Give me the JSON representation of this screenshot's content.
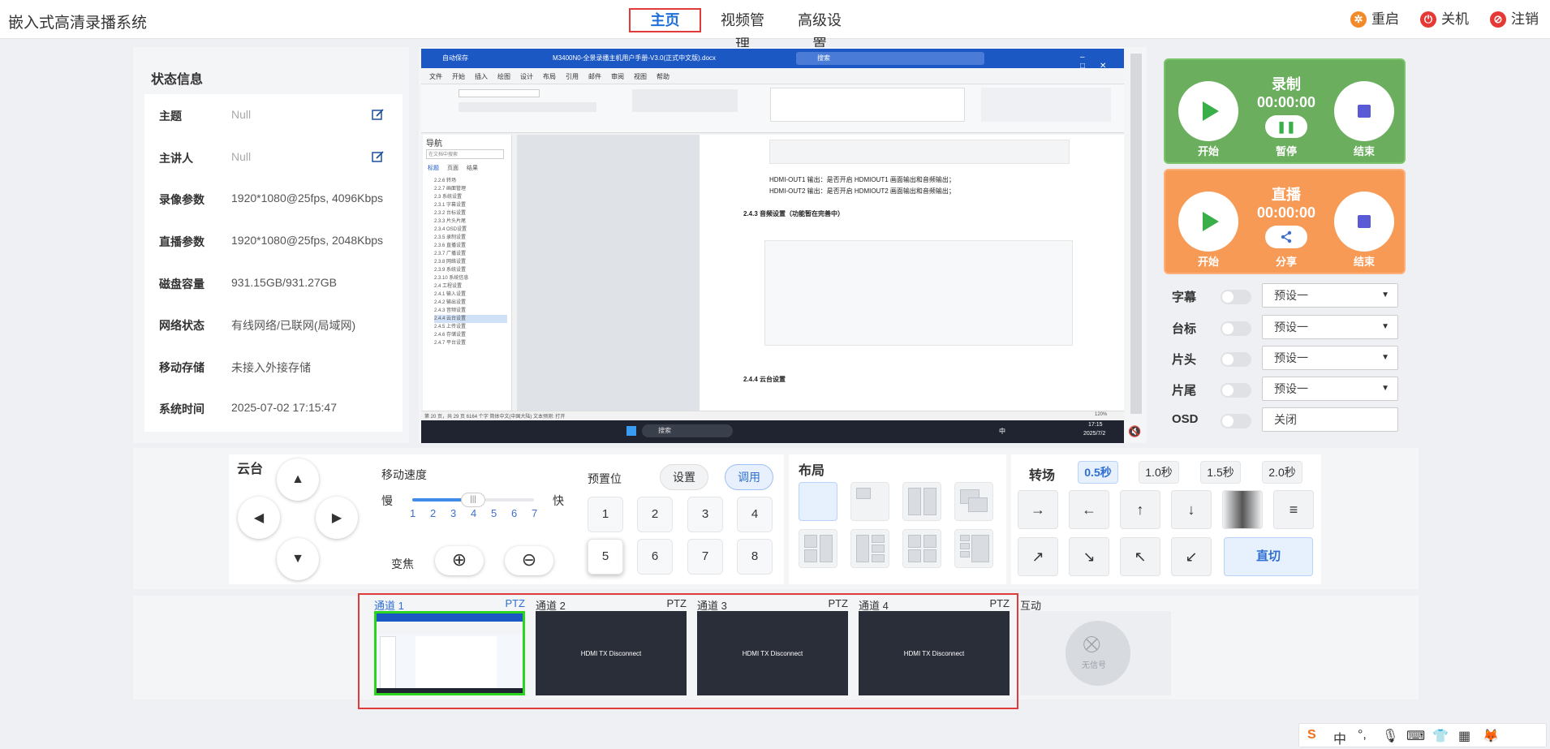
{
  "app": {
    "title": "嵌入式高清录播系统"
  },
  "nav": {
    "home": "主页",
    "video": "视频管理",
    "advanced": "高级设置"
  },
  "header_actions": {
    "restart": "重启",
    "shutdown": "关机",
    "logout": "注销"
  },
  "colors": {
    "accent": "#1e6fd9",
    "record_green": "#6aae5e",
    "live_orange": "#f79a55",
    "highlight_red": "#e03a3a",
    "selected_channel": "#2bd41f"
  },
  "status": {
    "title": "状态信息",
    "rows": [
      {
        "label": "主题",
        "value": "Null",
        "editable": true
      },
      {
        "label": "主讲人",
        "value": "Null",
        "editable": true
      },
      {
        "label": "录像参数",
        "value": "1920*1080@25fps, 4096Kbps"
      },
      {
        "label": "直播参数",
        "value": "1920*1080@25fps, 2048Kbps"
      },
      {
        "label": "磁盘容量",
        "value": "931.15GB/931.27GB"
      },
      {
        "label": "网络状态",
        "value": "有线网络/已联网(局域网)"
      },
      {
        "label": "移动存储",
        "value": "未接入外接存储"
      },
      {
        "label": "系统时间",
        "value": "2025-07-02 17:15:47"
      }
    ]
  },
  "preview": {
    "doc_title": "M3400N0-全景录播主机用户手册-V3.0(正式中文版).docx",
    "autosave": "自动保存",
    "search": "搜索",
    "ribbon_tabs": [
      "文件",
      "开始",
      "插入",
      "绘图",
      "设计",
      "布局",
      "引用",
      "邮件",
      "审阅",
      "视图",
      "帮助"
    ],
    "nav_pane_title": "导航",
    "nav_pane_search": "在文档中搜索",
    "nav_tabs": [
      "标题",
      "页面",
      "结果"
    ],
    "nav_items": [
      "2.2.6 转场",
      "2.2.7 画面管理",
      "2.3 系统设置",
      "2.3.1 字幕设置",
      "2.3.2 台标设置",
      "2.3.3 片头片尾",
      "2.3.4 OSD设置",
      "2.3.5 录制设置",
      "2.3.6 直播设置",
      "2.3.7 广播设置",
      "2.3.8 网络设置",
      "2.3.9 系统设置",
      "2.3.10 系统信息",
      "2.4 工程设置",
      "2.4.1 输入设置",
      "2.4.2 输出设置",
      "2.4.3 音频设置",
      "2.4.4 云台设置",
      "2.4.5 上传设置",
      "2.4.6 存储设置",
      "2.4.7 平台设置"
    ],
    "doc_lines": [
      "HDMI-OUT1 输出：是否开启 HDMIOUT1 画面输出和音频输出；",
      "HDMI-OUT2 输出：是否开启 HDMIOUT2 画面输出和音频输出；",
      "2.4.3 音频设置（功能暂在完善中）",
      "2.4.4 云台设置"
    ],
    "statusbar": "第 20 页，共 29 页   6164 个字   简体中文(中国大陆)   文本预测: 打开",
    "zoom": "120%",
    "task_search": "搜索",
    "clock_time": "17:15",
    "clock_date": "2025/7/2",
    "ime_lang": "中"
  },
  "record": {
    "title": "录制",
    "time": "00:00:00",
    "start": "开始",
    "pause": "暂停",
    "stop": "结束"
  },
  "live": {
    "title": "直播",
    "time": "00:00:00",
    "start": "开始",
    "share": "分享",
    "stop": "结束"
  },
  "overlays": [
    {
      "label": "字幕",
      "value": "预设一",
      "enabled": false
    },
    {
      "label": "台标",
      "value": "预设一",
      "enabled": false
    },
    {
      "label": "片头",
      "value": "预设一",
      "enabled": false
    },
    {
      "label": "片尾",
      "value": "预设一",
      "enabled": false
    },
    {
      "label": "OSD",
      "value": "关闭",
      "enabled": false
    }
  ],
  "ptz": {
    "title": "云台",
    "speed_label": "移动速度",
    "slow": "慢",
    "fast": "快",
    "speeds": [
      "1",
      "2",
      "3",
      "4",
      "5",
      "6",
      "7"
    ],
    "speed_value": 4,
    "zoom_label": "变焦",
    "preset_label": "预置位",
    "preset_set": "设置",
    "preset_call": "调用",
    "presets": [
      "1",
      "2",
      "3",
      "4",
      "5",
      "6",
      "7",
      "8"
    ],
    "selected_preset": "5"
  },
  "layout": {
    "title": "布局",
    "selected_index": 0
  },
  "transition": {
    "title": "转场",
    "speeds": [
      "0.5秒",
      "1.0秒",
      "1.5秒",
      "2.0秒"
    ],
    "selected_speed": "0.5秒",
    "effects": [
      "arrow-right-icon",
      "arrow-left-icon",
      "arrow-up-icon",
      "arrow-down-icon",
      "fade-icon",
      "lines-icon",
      "arrow-up-right-icon",
      "arrow-down-right-icon",
      "arrow-up-left-icon",
      "arrow-down-left-icon"
    ],
    "cut": "直切"
  },
  "channels": [
    {
      "name": "通道 1",
      "ptz": "PTZ",
      "screen": "",
      "selected": true
    },
    {
      "name": "通道 2",
      "ptz": "PTZ",
      "screen": "HDMI TX Disconnect"
    },
    {
      "name": "通道 3",
      "ptz": "PTZ",
      "screen": "HDMI TX Disconnect"
    },
    {
      "name": "通道 4",
      "ptz": "PTZ",
      "screen": "HDMI TX Disconnect"
    },
    {
      "name": "互动",
      "ptz": "",
      "screen": "无信号"
    }
  ],
  "ime_tray": {
    "lang": "中"
  }
}
